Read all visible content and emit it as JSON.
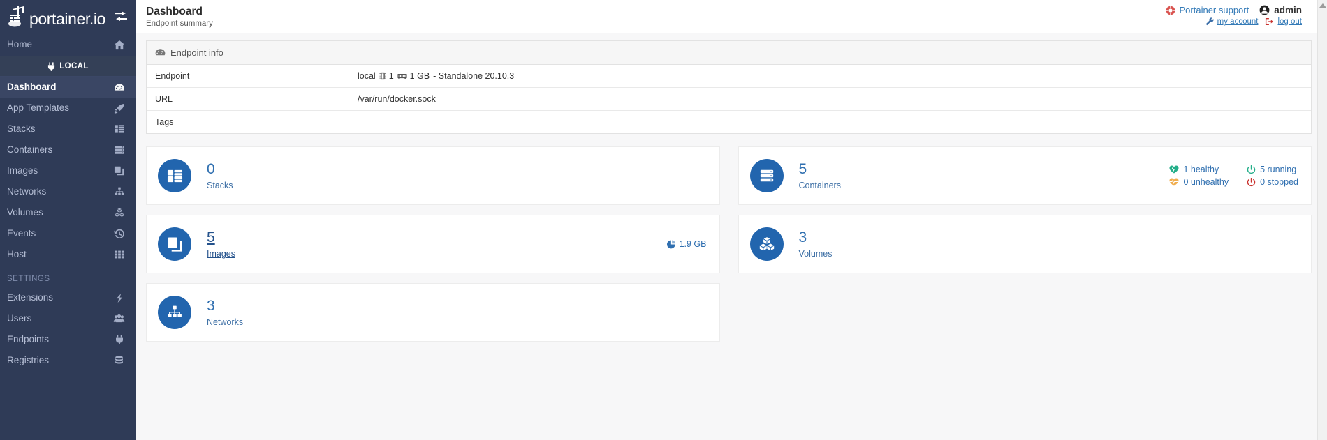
{
  "sidebar": {
    "brand": "portainer.io",
    "toggle_icon": "toggle-sidebar-icon",
    "home": {
      "label": "Home",
      "icon": "home-icon"
    },
    "local_badge": {
      "label": "LOCAL",
      "icon": "plug-icon"
    },
    "items": [
      {
        "label": "Dashboard",
        "icon": "dashboard-icon",
        "active": true
      },
      {
        "label": "App Templates",
        "icon": "rocket-icon",
        "active": false
      },
      {
        "label": "Stacks",
        "icon": "table-icon",
        "active": false
      },
      {
        "label": "Containers",
        "icon": "server-icon",
        "active": false
      },
      {
        "label": "Images",
        "icon": "clone-icon",
        "active": false
      },
      {
        "label": "Networks",
        "icon": "sitemap-icon",
        "active": false
      },
      {
        "label": "Volumes",
        "icon": "cubes-icon",
        "active": false
      },
      {
        "label": "Events",
        "icon": "history-icon",
        "active": false
      },
      {
        "label": "Host",
        "icon": "th-icon",
        "active": false
      }
    ],
    "settings_title": "SETTINGS",
    "settings_items": [
      {
        "label": "Extensions",
        "icon": "bolt-icon"
      },
      {
        "label": "Users",
        "icon": "users-icon"
      },
      {
        "label": "Endpoints",
        "icon": "plug-icon"
      },
      {
        "label": "Registries",
        "icon": "database-icon"
      }
    ]
  },
  "header": {
    "title": "Dashboard",
    "subtitle": "Endpoint summary",
    "support_label": "Portainer support",
    "support_icon": "lifebuoy-icon",
    "user_name": "admin",
    "user_icon": "user-circle-icon",
    "my_account_label": "my account",
    "my_account_icon": "wrench-icon",
    "log_out_label": "log out",
    "log_out_icon": "sign-out-icon"
  },
  "endpoint_info": {
    "panel_title": "Endpoint info",
    "panel_icon": "tachometer-icon",
    "rows": [
      {
        "key": "Endpoint",
        "value_name": "local",
        "cpu_icon": "microchip-icon",
        "cpu_value": "1",
        "memory_icon": "memory-icon",
        "memory_value": "1 GB",
        "suffix": "- Standalone 20.10.3"
      },
      {
        "key": "URL",
        "value": "/var/run/docker.sock"
      },
      {
        "key": "Tags",
        "value": ""
      }
    ]
  },
  "cards": {
    "stacks": {
      "count": "0",
      "label": "Stacks",
      "icon": "table-icon",
      "link": false
    },
    "images": {
      "count": "5",
      "label": "Images",
      "icon": "clone-icon",
      "link": true,
      "size_value": "1.9 GB",
      "size_icon": "pie-chart-icon"
    },
    "networks": {
      "count": "3",
      "label": "Networks",
      "icon": "sitemap-icon",
      "link": false
    },
    "containers": {
      "count": "5",
      "label": "Containers",
      "icon": "server-icon",
      "link": false,
      "status": [
        {
          "label": "1 healthy",
          "icon": "heartbeat-icon",
          "color": "#23ae89"
        },
        {
          "label": "5 running",
          "icon": "power-icon",
          "color": "#23ae89"
        },
        {
          "label": "0 unhealthy",
          "icon": "heartbeat-icon",
          "color": "#f0ad4e"
        },
        {
          "label": "0 stopped",
          "icon": "power-icon",
          "color": "#c9302c"
        }
      ]
    },
    "volumes": {
      "count": "3",
      "label": "Volumes",
      "icon": "cubes-icon",
      "link": false
    }
  },
  "colors": {
    "sidebar_bg": "#2f3b57",
    "sidebar_active_bg": "#3a4664",
    "accent_blue": "#2265ae",
    "link_blue": "#337ab7",
    "page_bg": "#f7f7f8"
  }
}
